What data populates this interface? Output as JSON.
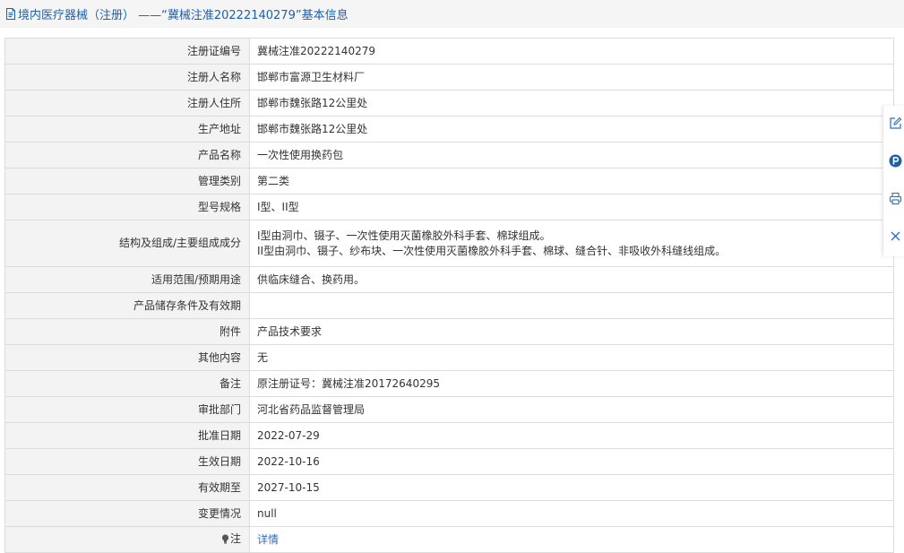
{
  "header": {
    "title": "境内医疗器械（注册） ——“冀械注准20222140279”基本信息",
    "icon": "document-icon"
  },
  "rows": [
    {
      "label": "注册证编号",
      "value": "冀械注准20222140279"
    },
    {
      "label": "注册人名称",
      "value": "邯郸市富源卫生材料厂"
    },
    {
      "label": "注册人住所",
      "value": "邯郸市魏张路12公里处"
    },
    {
      "label": "生产地址",
      "value": "邯郸市魏张路12公里处"
    },
    {
      "label": "产品名称",
      "value": "一次性使用换药包"
    },
    {
      "label": "管理类别",
      "value": "第二类"
    },
    {
      "label": "型号规格",
      "value": "I型、II型"
    },
    {
      "label": "结构及组成/主要组成成分",
      "value_line1": "I型由洞巾、镊子、一次性使用灭菌橡胶外科手套、棉球组成。",
      "value_line2": "II型由洞巾、镊子、纱布块、一次性使用灭菌橡胶外科手套、棉球、缝合针、非吸收外科缝线组成。"
    },
    {
      "label": "适用范围/预期用途",
      "value": "供临床缝合、换药用。"
    },
    {
      "label": "产品储存条件及有效期",
      "value": ""
    },
    {
      "label": "附件",
      "value": "产品技术要求"
    },
    {
      "label": "其他内容",
      "value": "无"
    },
    {
      "label": "备注",
      "value": "原注册证号：冀械注准20172640295"
    },
    {
      "label": "审批部门",
      "value": "河北省药品监督管理局"
    },
    {
      "label": "批准日期",
      "value": "2022-07-29"
    },
    {
      "label": "生效日期",
      "value": "2022-10-16"
    },
    {
      "label": "有效期至",
      "value": "2027-10-15"
    },
    {
      "label": "变更情况",
      "value": "null"
    },
    {
      "label": "注",
      "value": "详情",
      "icon": "lightbulb-icon"
    }
  ],
  "side_toolbar": {
    "tools": [
      "edit-icon",
      "parking-icon",
      "print-icon",
      "close-icon"
    ]
  },
  "colors": {
    "header_text": "#1f5fa9",
    "link": "#2c6ebf",
    "label_bg": "#f3f3f3",
    "border": "#dcdcdc"
  }
}
